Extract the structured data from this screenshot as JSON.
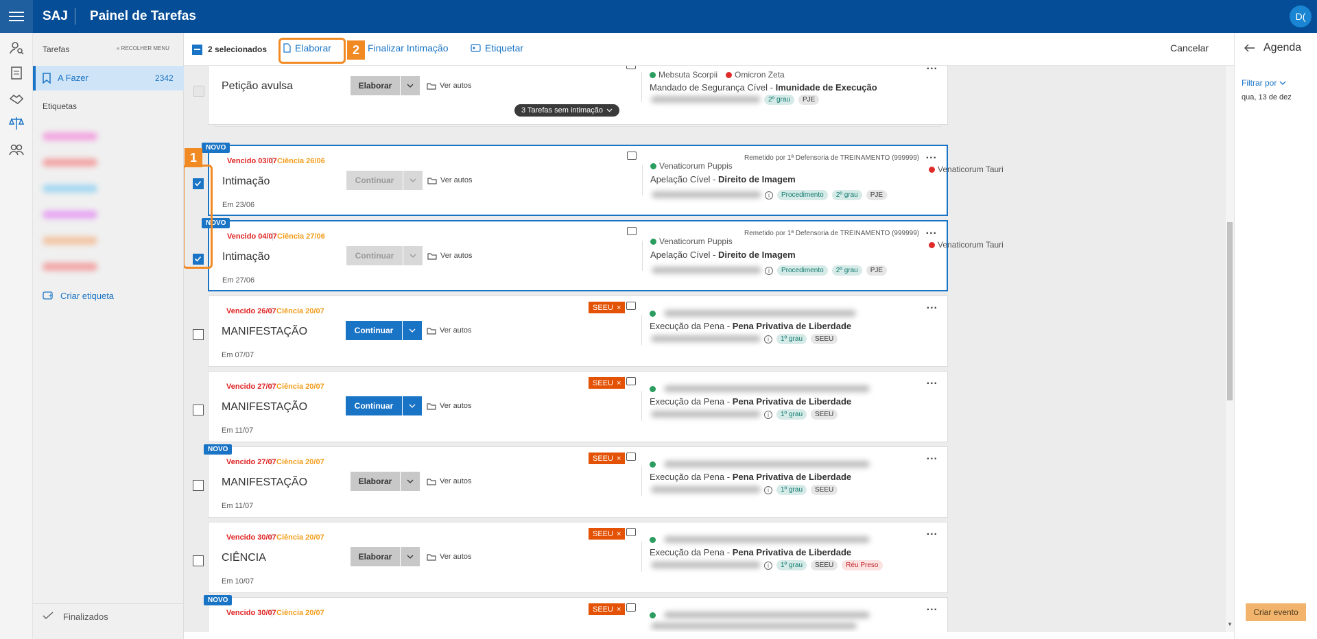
{
  "header": {
    "brand": "SAJ",
    "title": "Painel de Tarefas",
    "avatar": "D("
  },
  "sidebar": {
    "tarefas_label": "Tarefas",
    "recolher_label": "RECOLHER MENU",
    "afazer_label": "A Fazer",
    "afazer_count": "2342",
    "etiquetas_label": "Etiquetas",
    "criar_etiqueta": "Criar etiqueta",
    "finalizados": "Finalizados",
    "tag_colors": [
      "#f2a6e0",
      "#f2a6a6",
      "#a6d8f2",
      "#e6a6f2",
      "#f2c6a6",
      "#f2a6a6"
    ]
  },
  "toolbar": {
    "selected_label": "2 selecionados",
    "elaborar": "Elaborar",
    "finalizar": "Finalizar Intimação",
    "etiquetar": "Etiquetar",
    "cancelar": "Cancelar"
  },
  "callouts": {
    "one": "1",
    "two": "2"
  },
  "accent": "#1a74c6",
  "highlight": "#f18a23",
  "agenda": {
    "title": "Agenda",
    "filtrar": "Filtrar por",
    "date": "qua, 13 de dez",
    "criar_evento": "Criar evento"
  },
  "top_card": {
    "title": "Petição avulsa",
    "action": "Elaborar",
    "ver_autos": "Ver autos",
    "party1": "Mebsuta Scorpii",
    "party2": "Omicron Zeta",
    "case_type": "Mandado de Segurança Cível",
    "case_subject": "Imunidade de Execução",
    "badges": [
      "2º grau",
      "PJE"
    ],
    "group_label": "3 Tarefas sem intimação"
  },
  "cards": [
    {
      "novo": "NOVO",
      "venc": "Vencido 03/07",
      "cien": "Ciência 26/06",
      "title": "Intimação",
      "em": "Em 23/06",
      "action": "Continuar",
      "ver_autos": "Ver autos",
      "party1": "Venaticorum Puppis",
      "party2": "Venaticorum Tauri",
      "remetido": "Remetido  por 1ª Defensoria de TREINAMENTO (999999)",
      "case_type": "Apelação Cível",
      "case_subject": "Direito de Imagem",
      "badges": [
        "Procedimento",
        "2º grau",
        "PJE"
      ],
      "seeu": ""
    },
    {
      "novo": "NOVO",
      "venc": "Vencido 04/07",
      "cien": "Ciência 27/06",
      "title": "Intimação",
      "em": "Em 27/06",
      "action": "Continuar",
      "ver_autos": "Ver autos",
      "party1": "Venaticorum Puppis",
      "party2": "Venaticorum Tauri",
      "remetido": "Remetido  por 1ª Defensoria de TREINAMENTO (999999)",
      "case_type": "Apelação Cível",
      "case_subject": "Direito de Imagem",
      "badges": [
        "Procedimento",
        "2º grau",
        "PJE"
      ],
      "seeu": ""
    },
    {
      "novo": "",
      "venc": "Vencido 26/07",
      "cien": "Ciência 20/07",
      "title": "MANIFESTAÇÃO",
      "em": "Em 07/07",
      "action": "Continuar",
      "ver_autos": "Ver autos",
      "case_type": "Execução da Pena",
      "case_subject": "Pena Privativa de Liberdade",
      "badges": [
        "1º grau",
        "SEEU"
      ],
      "seeu": "SEEU"
    },
    {
      "novo": "",
      "venc": "Vencido 27/07",
      "cien": "Ciência 20/07",
      "title": "MANIFESTAÇÃO",
      "em": "Em 11/07",
      "action": "Continuar",
      "ver_autos": "Ver autos",
      "case_type": "Execução da Pena",
      "case_subject": "Pena Privativa de Liberdade",
      "badges": [
        "1º grau",
        "SEEU"
      ],
      "seeu": "SEEU"
    },
    {
      "novo": "NOVO",
      "venc": "Vencido 27/07",
      "cien": "Ciência 20/07",
      "title": "MANIFESTAÇÃO",
      "em": "Em 11/07",
      "action": "Elaborar",
      "ver_autos": "Ver autos",
      "case_type": "Execução da Pena",
      "case_subject": "Pena Privativa de Liberdade",
      "badges": [
        "1º grau",
        "SEEU"
      ],
      "seeu": "SEEU"
    },
    {
      "novo": "",
      "venc": "Vencido 30/07",
      "cien": "Ciência 20/07",
      "title": "CIÊNCIA",
      "em": "Em 10/07",
      "action": "Elaborar",
      "ver_autos": "Ver autos",
      "case_type": "Execução da Pena",
      "case_subject": "Pena Privativa de Liberdade",
      "badges": [
        "1º grau",
        "SEEU",
        "Réu Preso"
      ],
      "seeu": "SEEU"
    },
    {
      "novo": "NOVO",
      "venc": "Vencido 30/07",
      "cien": "Ciência 20/07",
      "seeu": "SEEU"
    }
  ]
}
